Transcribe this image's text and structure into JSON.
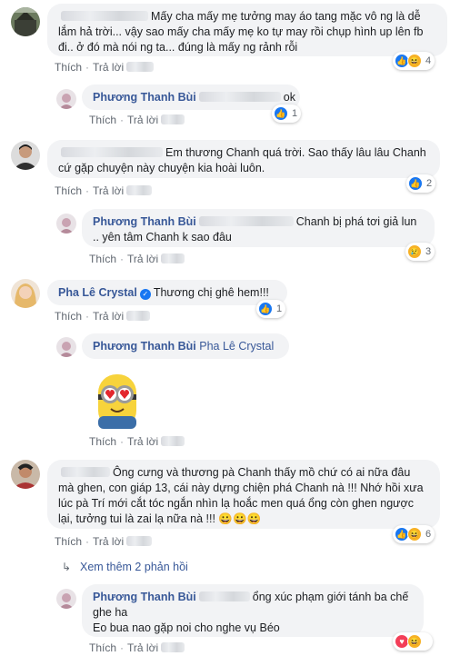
{
  "actions": {
    "like": "Thích",
    "reply": "Trả lời",
    "sep": "·"
  },
  "comments": [
    {
      "text": "Mấy cha mấy mẹ tưởng may áo tang mặc vô ng là dễ lắm hả trời... vậy sao mấy cha mấy mẹ ko tự may rồi chụp hình up lên fb đi.. ở đó mà nói ng ta... đúng là mấy ng rảnh rỗi",
      "reaction_count": "4",
      "reactions": [
        "like-icon",
        "haha-icon"
      ]
    },
    {
      "name": "Phương Thanh Bùi",
      "text": "ok",
      "reaction_count": "1",
      "reactions": [
        "like-icon"
      ]
    },
    {
      "text": "Em thương Chanh quá trời. Sao thấy lâu lâu Chanh cứ gặp chuyện này chuyện kia hoài luôn.",
      "reaction_count": "2",
      "reactions": [
        "like-icon"
      ]
    },
    {
      "name": "Phương Thanh Bùi",
      "text": "Chanh bị phá tơi giả lun .. yên tâm Chanh k sao đâu",
      "reaction_count": "3",
      "reactions": [
        "sad-icon"
      ]
    },
    {
      "name": "Pha Lê Crystal",
      "text": "Thương chị ghê hem!!!",
      "reaction_count": "1",
      "reactions": [
        "like-icon"
      ]
    },
    {
      "name": "Phương Thanh Bùi",
      "mention": "Pha Lê Crystal"
    },
    {
      "text": "Ông cưng và thương pà Chanh thấy mồ chứ có ai nữa đâu mà ghen, con giáp 13, cái này dựng chiện phá Chanh nà !!! Nhớ hồi xưa lúc pà Trí mới cắt tóc ngắn nhìn lạ hoắc men quá ổng còn ghen ngược lại, tưởng tui là zai lạ nữa nà !!! 😀😀😀",
      "reaction_count": "6",
      "reactions": [
        "like-icon",
        "haha-icon"
      ]
    },
    {
      "name": "Phương Thanh Bùi",
      "text": "ổng xúc phạm giới tánh ba chế ghe ha",
      "text2": "Eo bua nao gặp noi cho nghe vụ Béo",
      "reactions": [
        "love-icon",
        "haha-icon"
      ]
    }
  ],
  "see_more": "Xem thêm 2 phản hồi",
  "colors": {
    "name": "#385898",
    "bubble": "#f2f3f5",
    "meta": "#606770"
  }
}
